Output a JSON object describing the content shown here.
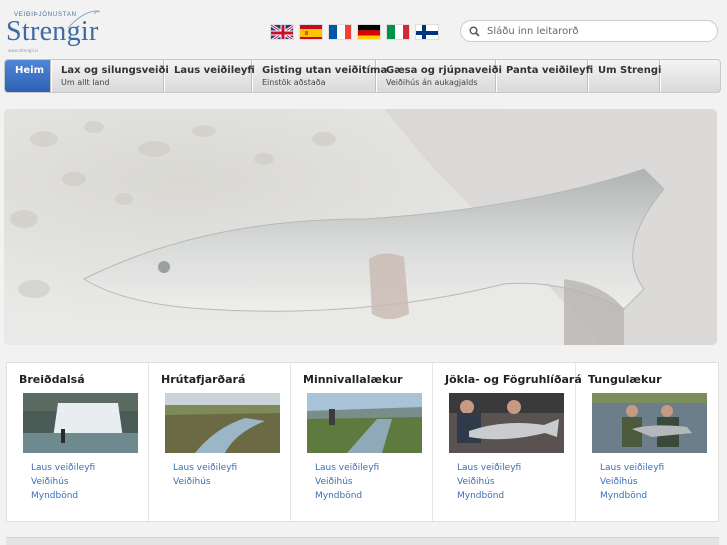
{
  "logo": {
    "tagline": "VEIÐIÞJÓNUSTAN",
    "wordmark": "Strengir",
    "url": "www.strengir.is"
  },
  "flags": [
    {
      "name": "uk-flag-icon"
    },
    {
      "name": "spain-flag-icon"
    },
    {
      "name": "france-flag-icon"
    },
    {
      "name": "germany-flag-icon"
    },
    {
      "name": "italy-flag-icon"
    },
    {
      "name": "finland-flag-icon"
    }
  ],
  "search": {
    "placeholder": "Sláðu inn leitarorð"
  },
  "nav": [
    {
      "title": "Heim",
      "sub": ""
    },
    {
      "title": "Lax og silungsveiði",
      "sub": "Um allt land"
    },
    {
      "title": "Laus veiðileyfi",
      "sub": ""
    },
    {
      "title": "Gisting utan veiðitíma",
      "sub": "Einstök aðstaða"
    },
    {
      "title": "Gæsa og rjúpnaveiði",
      "sub": "Veiðihús án aukagjalds"
    },
    {
      "title": "Panta veiðileyfi",
      "sub": ""
    },
    {
      "title": "Um Strengi",
      "sub": ""
    }
  ],
  "panels": [
    {
      "title": "Breiðdalsá",
      "links": [
        "Laus veiðileyfi",
        "Veiðihús",
        "Myndbönd"
      ]
    },
    {
      "title": "Hrútafjarðará",
      "links": [
        "Laus veiðileyfi",
        "Veiðihús"
      ]
    },
    {
      "title": "Minnivallalækur",
      "links": [
        "Laus veiðileyfi",
        "Veiðihús",
        "Myndbönd"
      ]
    },
    {
      "title": "Jökla- og Fögruhlíðará",
      "links": [
        "Laus veiðileyfi",
        "Veiðihús",
        "Myndbönd"
      ]
    },
    {
      "title": "Tungulækur",
      "links": [
        "Laus veiðileyfi",
        "Veiðihús",
        "Myndbönd"
      ]
    }
  ],
  "colors": {
    "accent": "#3e6aa5",
    "nav_active": "#3a70c6",
    "link": "#3a6fb5"
  }
}
